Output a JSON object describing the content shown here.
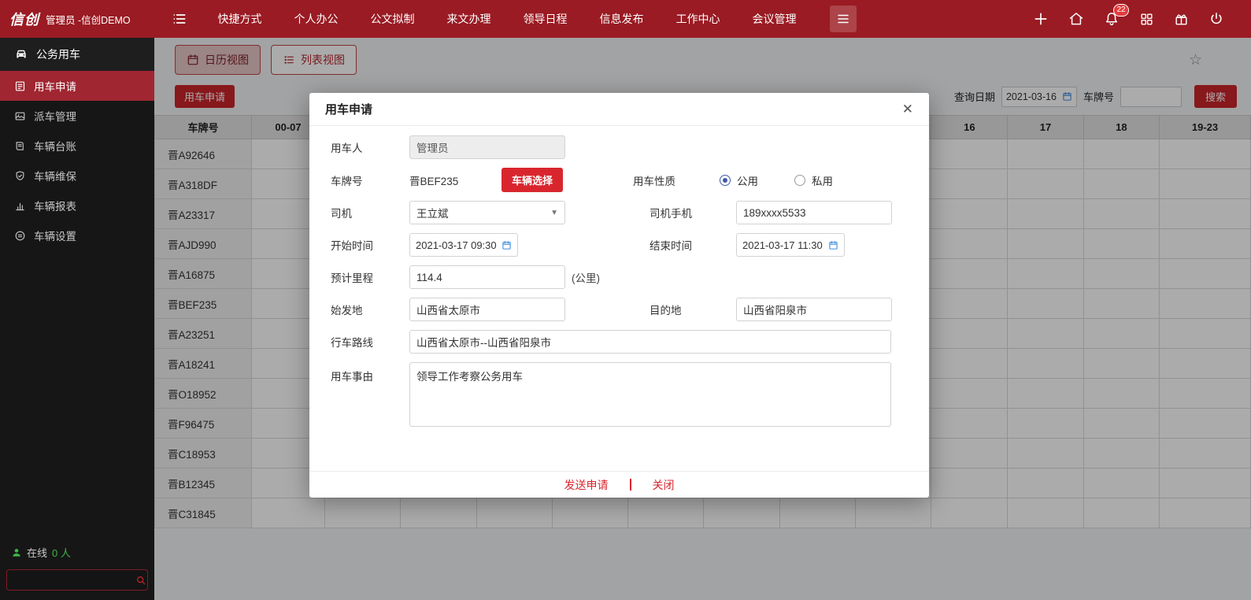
{
  "colors": {
    "topbar_bg": "#9a1b23",
    "sidebar_bg": "#161616",
    "sidebar_active_bg": "#a02631",
    "accent_red": "#c9252b",
    "button_red": "#d9262e",
    "radio_selected_blue": "#3f5aa8",
    "calendar_icon_blue": "#3e8ddd",
    "online_green": "#3cb54a"
  },
  "topbar": {
    "logo": "信创",
    "user_label": "管理员 -信创DEMO",
    "nav": [
      "快捷方式",
      "个人办公",
      "公文拟制",
      "来文办理",
      "领导日程",
      "信息发布",
      "工作中心",
      "会议管理"
    ],
    "notification_badge": "22"
  },
  "sidebar": {
    "module_title": "公务用车",
    "items": [
      {
        "label": "用车申请",
        "active": true
      },
      {
        "label": "派车管理",
        "active": false
      },
      {
        "label": "车辆台账",
        "active": false
      },
      {
        "label": "车辆维保",
        "active": false
      },
      {
        "label": "车辆报表",
        "active": false
      },
      {
        "label": "车辆设置",
        "active": false
      }
    ],
    "online_label": "在线",
    "online_count": "0 人"
  },
  "content": {
    "view_tabs": {
      "calendar": "日历视图",
      "list": "列表视图"
    },
    "apply_button": "用车申请",
    "filters": {
      "date_label": "查询日期",
      "date_value": "2021-03-16",
      "plate_label": "车牌号",
      "plate_value": "",
      "search_button": "搜索"
    },
    "table": {
      "columns": [
        "车牌号",
        "00-07",
        "",
        "",
        "",
        "",
        "",
        "",
        "",
        "",
        "16",
        "17",
        "18",
        "19-23"
      ],
      "rows": [
        "晋A92646",
        "晋A318DF",
        "晋A23317",
        "晋AJD990",
        "晋A16875",
        "晋BEF235",
        "晋A23251",
        "晋A18241",
        "晋O18952",
        "晋F96475",
        "晋C18953",
        "晋B12345",
        "晋C31845"
      ]
    }
  },
  "modal": {
    "title": "用车申请",
    "close_icon": "✕",
    "user_label": "用车人",
    "user_value": "管理员",
    "plate_label": "车牌号",
    "plate_value": "晋BEF235",
    "vehicle_select_button": "车辆选择",
    "nature_label": "用车性质",
    "nature_public": "公用",
    "nature_private": "私用",
    "nature_selected": "公用",
    "driver_label": "司机",
    "driver_value": "王立斌",
    "phone_label": "司机手机",
    "phone_value": "189xxxx5533",
    "start_label": "开始时间",
    "start_value": "2021-03-17 09:30",
    "end_label": "结束时间",
    "end_value": "2021-03-17 11:30",
    "mileage_label": "预计里程",
    "mileage_value": "114.4",
    "mileage_unit": "(公里)",
    "origin_label": "始发地",
    "origin_value": "山西省太原市",
    "dest_label": "目的地",
    "dest_value": "山西省阳泉市",
    "route_label": "行车路线",
    "route_value": "山西省太原市--山西省阳泉市",
    "reason_label": "用车事由",
    "reason_value": "领导工作考察公务用车",
    "send_button": "发送申请",
    "close_button": "关闭"
  }
}
